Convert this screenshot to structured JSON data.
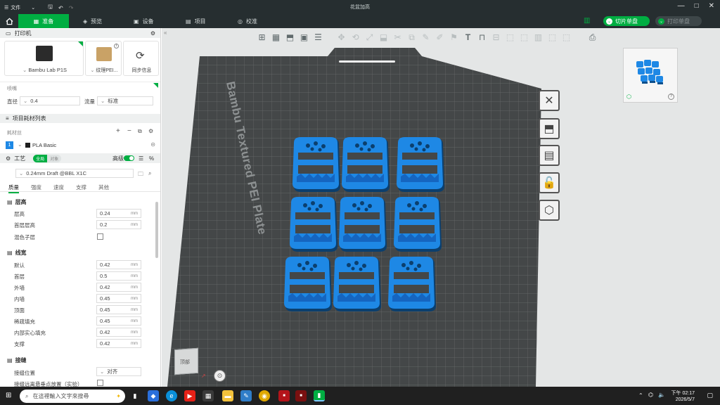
{
  "titlebar": {
    "menu_label": "文件",
    "title": "花盆加高",
    "minimize": "—",
    "maximize": "□",
    "close": "✕"
  },
  "tabs": [
    {
      "label": "准备"
    },
    {
      "label": "预览"
    },
    {
      "label": "设备"
    },
    {
      "label": "项目"
    },
    {
      "label": "校准"
    }
  ],
  "actions": {
    "slice_label": "切片单盘",
    "print_label": "打印单盘"
  },
  "printer": {
    "section_title": "打印机",
    "printer_name": "Bambu Lab P1S",
    "plate_name": "纹理PEI...",
    "sync_label": "同步信息",
    "nozzle_section": "喷嘴",
    "diameter_label": "直径",
    "diameter_value": "0.4",
    "flow_label": "流量",
    "flow_value": "标准"
  },
  "filament": {
    "section_title": "项目耗材列表",
    "sub_label": "耗材丝",
    "slot_number": "1",
    "filament_name": "PLA Basic",
    "filament_color": "#1e1e1e"
  },
  "process": {
    "section_title": "工艺",
    "toggle_global": "全局",
    "toggle_object": "对象",
    "advanced_label": "高级",
    "profile_name": "0.24mm Draft @BBL X1C",
    "tabs": [
      "质量",
      "强度",
      "速度",
      "支撑",
      "其他"
    ],
    "groups": [
      {
        "title": "层高",
        "rows": [
          {
            "label": "层高",
            "value": "0.24",
            "unit": "mm"
          },
          {
            "label": "首层层高",
            "value": "0.2",
            "unit": "mm"
          },
          {
            "label": "混色子层",
            "value": "",
            "unit": "",
            "checkbox": true
          }
        ]
      },
      {
        "title": "线宽",
        "rows": [
          {
            "label": "默认",
            "value": "0.42",
            "unit": "mm"
          },
          {
            "label": "首层",
            "value": "0.5",
            "unit": "mm"
          },
          {
            "label": "外墙",
            "value": "0.42",
            "unit": "mm"
          },
          {
            "label": "内墙",
            "value": "0.45",
            "unit": "mm"
          },
          {
            "label": "顶面",
            "value": "0.45",
            "unit": "mm"
          },
          {
            "label": "稀疏填充",
            "value": "0.45",
            "unit": "mm"
          },
          {
            "label": "内部实心填充",
            "value": "0.42",
            "unit": "mm"
          },
          {
            "label": "支撑",
            "value": "0.42",
            "unit": "mm"
          }
        ]
      },
      {
        "title": "接缝",
        "rows": [
          {
            "label": "接缝位置",
            "value": "对齐",
            "unit": ""
          },
          {
            "label": "接缝远离悬垂点放置（实验）",
            "value": "",
            "unit": "",
            "checkbox": true
          }
        ]
      }
    ]
  },
  "viewport": {
    "plate_label": "Bambu Textured PEI Plate",
    "view_cube_label": "顶部",
    "accent": "#1e88e5",
    "brand_green": "#00ae42"
  },
  "taskbar": {
    "search_placeholder": "在這裡輸入文字來搜尋",
    "time": "下午 02:17",
    "date": "2026/5/7"
  }
}
